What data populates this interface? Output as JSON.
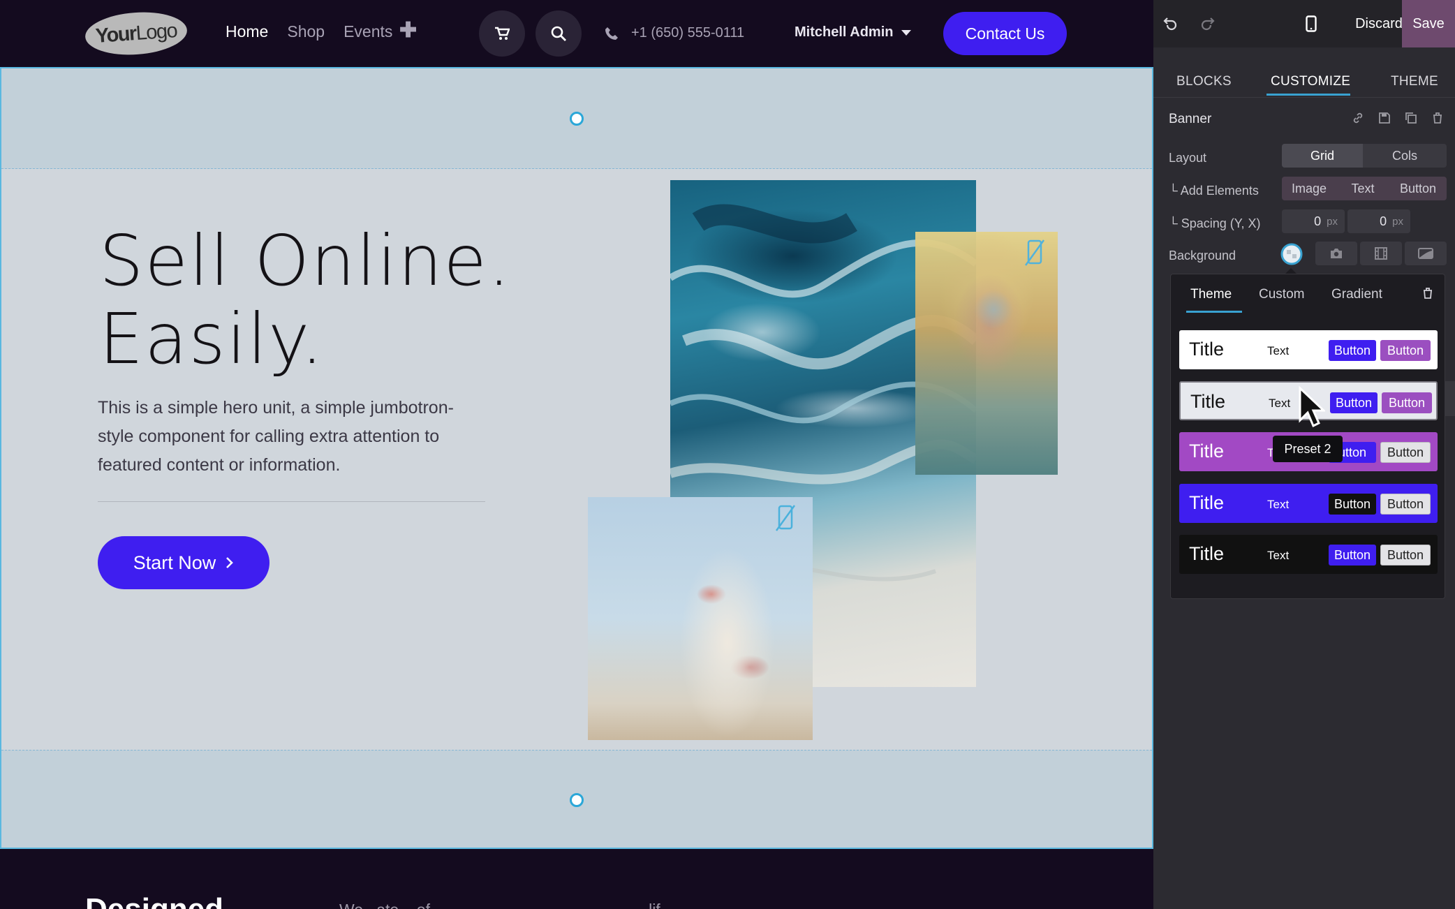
{
  "site": {
    "logo": {
      "part1": "Your",
      "part2": "Logo"
    },
    "nav": {
      "home": "Home",
      "shop": "Shop",
      "events": "Events"
    },
    "phone": "+1 (650) 555-0111",
    "user": "Mitchell Admin",
    "contact_label": "Contact Us"
  },
  "hero": {
    "title_line1": "Sell Online.",
    "title_line2": "Easily.",
    "text": "This is a simple hero unit, a simple jumbotron-style component for calling extra attention to featured content or information.",
    "cta_label": "Start Now",
    "images": [
      "blue marble swirl",
      "woman with sunglasses",
      "floral dress"
    ]
  },
  "below": {
    "title": "Designed",
    "text": "We...ate... of .... . ....... ...... . .... ....... .... . .. .lif..."
  },
  "editor": {
    "discard_label": "Discard",
    "save_label": "Save",
    "tabs": {
      "blocks": "BLOCKS",
      "customize": "CUSTOMIZE",
      "theme": "THEME"
    },
    "block_name": "Banner",
    "layout": {
      "label": "Layout",
      "options": [
        "Grid",
        "Cols"
      ],
      "selected": "Grid"
    },
    "add_elements": {
      "label": "└ Add Elements",
      "options": [
        "Image",
        "Text",
        "Button"
      ]
    },
    "spacing": {
      "label": "└ Spacing (Y, X)",
      "y": "0",
      "x": "0",
      "unit": "px"
    },
    "background": {
      "label": "Background"
    },
    "popup": {
      "tabs": [
        "Theme",
        "Custom",
        "Gradient"
      ],
      "active_tab": "Theme",
      "presets": [
        {
          "title": "Title",
          "text": "Text",
          "btn1": "Button",
          "btn2": "Button",
          "bg": "#ffffff",
          "fg": "#111111",
          "btn1_bg": "#3f1ef0",
          "btn2_bg": "#9b4fc0",
          "btn2_fg": "#ffffff"
        },
        {
          "title": "Title",
          "text": "Text",
          "btn1": "Button",
          "btn2": "Button",
          "bg": "#e7e9ee",
          "fg": "#111111",
          "btn1_bg": "#3f1ef0",
          "btn2_bg": "#9b4fc0",
          "btn2_fg": "#ffffff"
        },
        {
          "title": "Title",
          "text": "T",
          "btn1": "utton",
          "btn2": "Button",
          "bg": "#a249c4",
          "fg": "#ffffff",
          "btn1_bg": "#3f1ef0",
          "btn2_bg": "#e3e3e6",
          "btn2_fg": "#222222"
        },
        {
          "title": "Title",
          "text": "Text",
          "btn1": "Button",
          "btn2": "Button",
          "bg": "#3f1ef0",
          "fg": "#ffffff",
          "btn1_bg": "#111111",
          "btn2_bg": "#e3e3e6",
          "btn2_fg": "#222222"
        },
        {
          "title": "Title",
          "text": "Text",
          "btn1": "Button",
          "btn2": "Button",
          "bg": "#111111",
          "fg": "#ffffff",
          "btn1_bg": "#3f1ef0",
          "btn2_bg": "#e3e3e6",
          "btn2_fg": "#222222"
        }
      ]
    },
    "tooltip": "Preset 2"
  },
  "colors": {
    "accent": "#3f1ef0",
    "selection": "#39a2d1",
    "save": "#6e4a6e"
  }
}
